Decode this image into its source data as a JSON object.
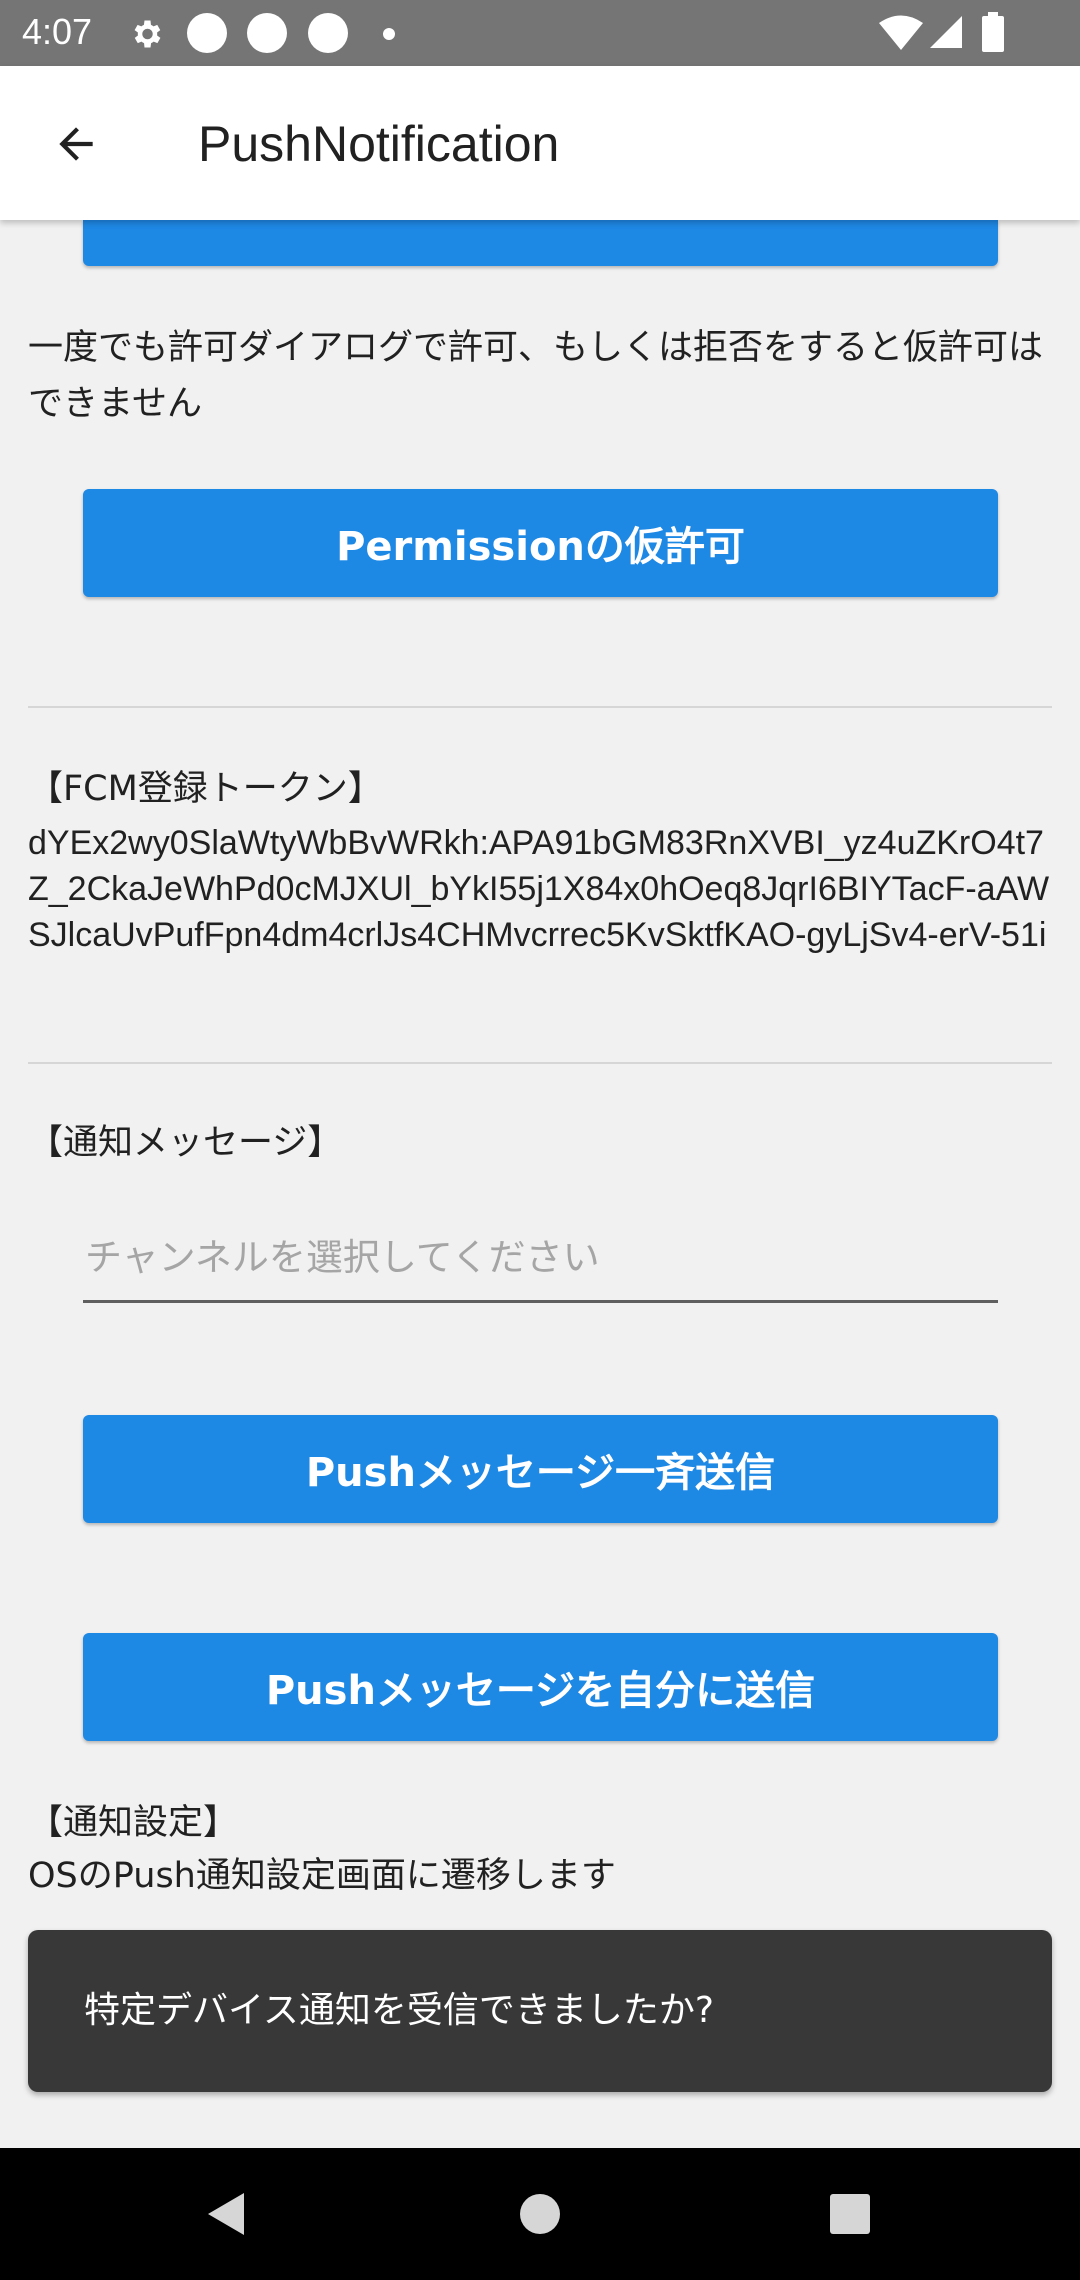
{
  "status_bar": {
    "time": "4:07",
    "icons": [
      "gear-icon",
      "circle-icon",
      "circle-icon",
      "circle-icon",
      "dot-icon",
      "wifi-icon",
      "signal-icon",
      "battery-icon"
    ]
  },
  "app_bar": {
    "title": "PushNotification",
    "back_icon": "arrow-back-icon"
  },
  "content": {
    "provisional_note": "一度でも許可ダイアログで許可、もしくは拒否をすると仮許可はできません",
    "provisional_button": "Permissionの仮許可",
    "fcm_token_heading": "【FCM登録トークン】",
    "fcm_token_value": "dYEx2wy0SlaWtyWbBvWRkh:APA91bGM83RnXVBI_yz4uZKrO4t7Z_2CkaJeWhPd0cMJXUl_bYkI55j1X84x0hOeq8JqrI6BIYTacF-aAWSJlcaUvPufFpn4dm4crlJs4CHMvcrrec5KvSktfKAO-gyLjSv4-erV-51i",
    "notification_message_heading": "【通知メッセージ】",
    "channel_select_placeholder": "チャンネルを選択してください",
    "broadcast_button": "Pushメッセージ一斉送信",
    "send_self_button": "Pushメッセージを自分に送信",
    "notification_settings_heading": "【通知設定】",
    "notification_settings_desc": "OSのPush通知設定画面に遷移します"
  },
  "snackbar": {
    "text": "特定デバイス通知を受信できましたか?"
  },
  "nav_bar": {
    "icons": [
      "back-triangle-icon",
      "home-circle-icon",
      "recents-square-icon"
    ]
  },
  "colors": {
    "accent": "#1e88e5",
    "status_bar": "#757575",
    "background": "#f1f1f1",
    "snackbar": "#383838"
  }
}
